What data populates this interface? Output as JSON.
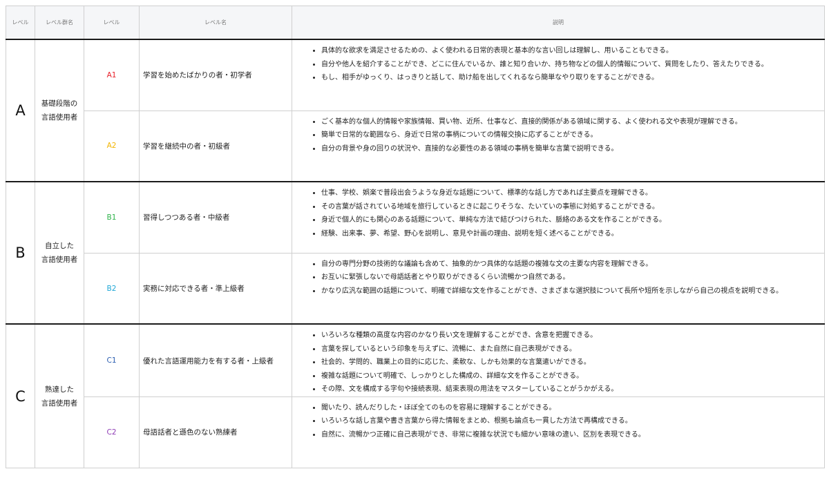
{
  "headers": {
    "level": "レベル",
    "group": "レベル群名",
    "sublevel": "レベル",
    "name": "レベル名",
    "description": "説明"
  },
  "groups": [
    {
      "letter": "A",
      "name_line1": "基礎段階の",
      "name_line2": "言語使用者",
      "levels": [
        {
          "code": "A1",
          "color": "#e8202a",
          "name": "学習を始めたばかりの者・初学者",
          "items": [
            "具体的な欲求を満足させるための、よく使われる日常的表現と基本的な言い回しは理解し、用いることもできる。",
            "自分や他人を紹介することができ、どこに住んでいるか、誰と知り合いか、持ち物などの個人的情報について、質問をしたり、答えたりできる。",
            "もし、相手がゆっくり、はっきりと話して、助け船を出してくれるなら簡単なやり取りをすることができる。"
          ]
        },
        {
          "code": "A2",
          "color": "#f2b400",
          "name": "学習を継続中の者・初級者",
          "items": [
            "ごく基本的な個人的情報や家族情報、買い物、近所、仕事など、直接的関係がある領域に関する、よく使われる文や表現が理解できる。",
            "簡単で日常的な範囲なら、身近で日常の事柄についての情報交換に応ずることができる。",
            "自分の背景や身の回りの状況や、直接的な必要性のある領域の事柄を簡単な言葉で説明できる。"
          ]
        }
      ]
    },
    {
      "letter": "B",
      "name_line1": "自立した",
      "name_line2": "言語使用者",
      "levels": [
        {
          "code": "B1",
          "color": "#2db34a",
          "name": "習得しつつある者・中級者",
          "items": [
            "仕事、学校、娯楽で普段出会うような身近な話題について、標準的な話し方であれば主要点を理解できる。",
            "その言葉が話されている地域を旅行しているときに起こりそうな、たいていの事態に対処することができる。",
            "身近で個人的にも関心のある話題について、単純な方法で結びつけられた、脈絡のある文を作ることができる。",
            "経験、出来事、夢、希望、野心を説明し、意見や計画の理由、説明を短く述べることができる。"
          ]
        },
        {
          "code": "B2",
          "color": "#1ea7d6",
          "name": "実務に対応できる者・準上級者",
          "items": [
            "自分の専門分野の技術的な議論も含めて、抽象的かつ具体的な話題の複雑な文の主要な内容を理解できる。",
            "お互いに緊張しないで母語話者とやり取りができるくらい流暢かつ自然である。",
            "かなり広汎な範囲の話題について、明確で詳細な文を作ることができ、さまざまな選択肢について長所や短所を示しながら自己の視点を説明できる。"
          ]
        }
      ]
    },
    {
      "letter": "C",
      "name_line1": "熟達した",
      "name_line2": "言語使用者",
      "levels": [
        {
          "code": "C1",
          "color": "#2a5db0",
          "name": "優れた言語運用能力を有する者・上級者",
          "items": [
            "いろいろな種類の高度な内容のかなり長い文を理解することができ、含意を把握できる。",
            "言葉を探しているという印象を与えずに、流暢に、また自然に自己表現ができる。",
            "社会的、学問的、職業上の目的に応じた、柔軟な、しかも効果的な言葉遣いができる。",
            "複雑な話題について明確で、しっかりとした構成の、詳細な文を作ることができる。",
            "その際、文を構成する字句や接続表現、結束表現の用法をマスターしていることがうかがえる。"
          ]
        },
        {
          "code": "C2",
          "color": "#8e3bb5",
          "name": "母語話者と遜色のない熟練者",
          "items": [
            "聞いたり、読んだりした・ほぼ全てのものを容易に理解することができる。",
            "いろいろな話し言葉や書き言葉から得た情報をまとめ、根拠も論点も一貫した方法で再構成できる。",
            "自然に、流暢かつ正確に自己表現ができ、非常に複雑な状況でも細かい意味の違い、区別を表現できる。"
          ]
        }
      ]
    }
  ]
}
